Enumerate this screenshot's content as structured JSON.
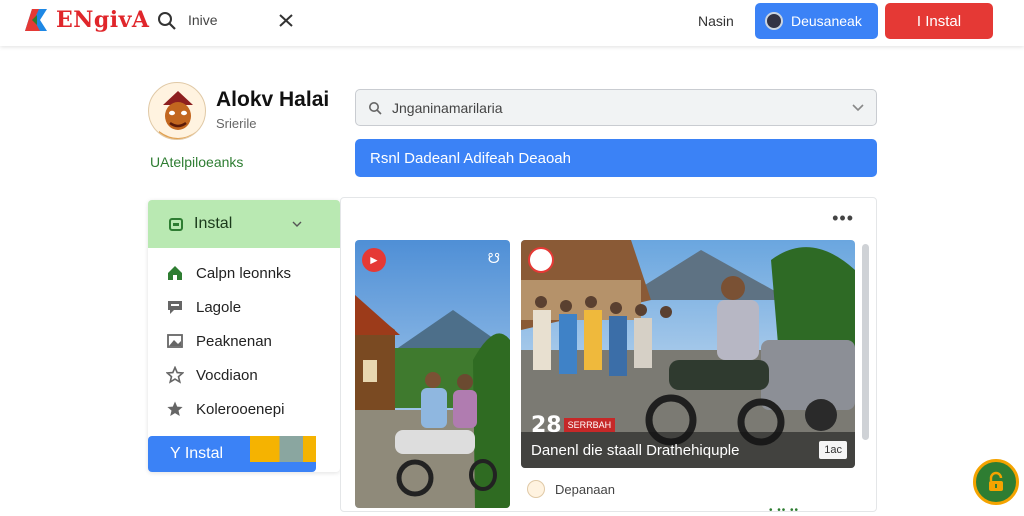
{
  "header": {
    "brand": "ENgivA",
    "search_text": "Inive",
    "name_link": "Nasin",
    "download_label": "Deusaneak",
    "install_label": "I Instal"
  },
  "profile": {
    "name": "Alokv Halai",
    "subtitle": "Srierile",
    "link": "UAtelpiloeanks"
  },
  "main": {
    "select_value": "Jnganinamarilaria",
    "banner_text": "Rsnl Dadeanl Adifeah Deaoah"
  },
  "sidebar": {
    "header_label": "Instal",
    "items": [
      {
        "label": "Calpn leonnks",
        "icon": "house-icon"
      },
      {
        "label": "Lagole",
        "icon": "chat-icon"
      },
      {
        "label": "Peaknenan",
        "icon": "image-icon"
      },
      {
        "label": "Vocdiaon",
        "icon": "star-outline-icon"
      },
      {
        "label": "Kolerooenepi",
        "icon": "star-icon"
      }
    ],
    "install_button": "Y Instal"
  },
  "feed": {
    "more_label": "•••",
    "card2_caption": "Danenl die staall Drathehiquple",
    "card2_count": "1ac",
    "card2_number": "28",
    "card2_tag": "SERRBAH",
    "author": "Depanaan",
    "footer_dots": "• •• ••"
  },
  "colors": {
    "accent_blue": "#3b82f6",
    "install_red": "#e53935",
    "sidebar_green": "#b9e9b2",
    "link_green": "#2e7d32"
  }
}
